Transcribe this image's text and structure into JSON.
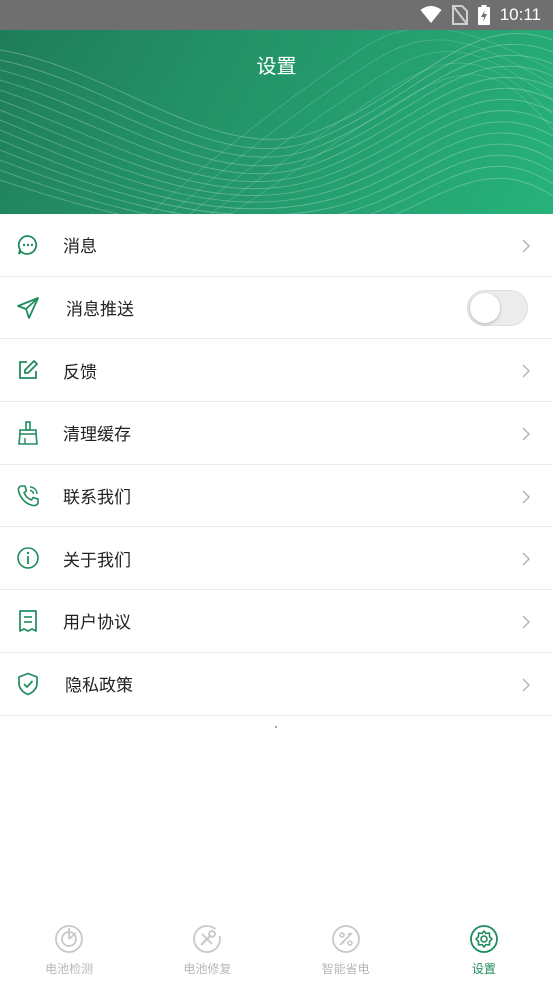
{
  "status_bar": {
    "time": "10:11",
    "icons": [
      "wifi-icon",
      "no-sim-icon",
      "battery-charging-icon"
    ]
  },
  "header": {
    "title": "设置"
  },
  "menu": {
    "items": [
      {
        "label": "消息",
        "icon": "chat-bubble-icon",
        "control": "chevron"
      },
      {
        "label": "消息推送",
        "icon": "paper-plane-icon",
        "control": "toggle",
        "toggle_on": false
      },
      {
        "label": "反馈",
        "icon": "edit-icon",
        "control": "chevron"
      },
      {
        "label": "清理缓存",
        "icon": "broom-icon",
        "control": "chevron"
      },
      {
        "label": "联系我们",
        "icon": "phone-icon",
        "control": "chevron"
      },
      {
        "label": "关于我们",
        "icon": "info-icon",
        "control": "chevron"
      },
      {
        "label": "用户协议",
        "icon": "document-icon",
        "control": "chevron"
      },
      {
        "label": "隐私政策",
        "icon": "shield-check-icon",
        "control": "chevron"
      }
    ]
  },
  "tabbar": {
    "tabs": [
      {
        "label": "电池检测",
        "icon": "battery-detect-icon",
        "active": false
      },
      {
        "label": "电池修复",
        "icon": "battery-repair-icon",
        "active": false
      },
      {
        "label": "智能省电",
        "icon": "smart-save-icon",
        "active": false
      },
      {
        "label": "设置",
        "icon": "settings-icon",
        "active": true
      }
    ]
  },
  "colors": {
    "accent": "#1f8c5e",
    "header_dark": "#1f7d5a",
    "header_light": "#27b27b",
    "inactive": "#b8b8b8"
  }
}
